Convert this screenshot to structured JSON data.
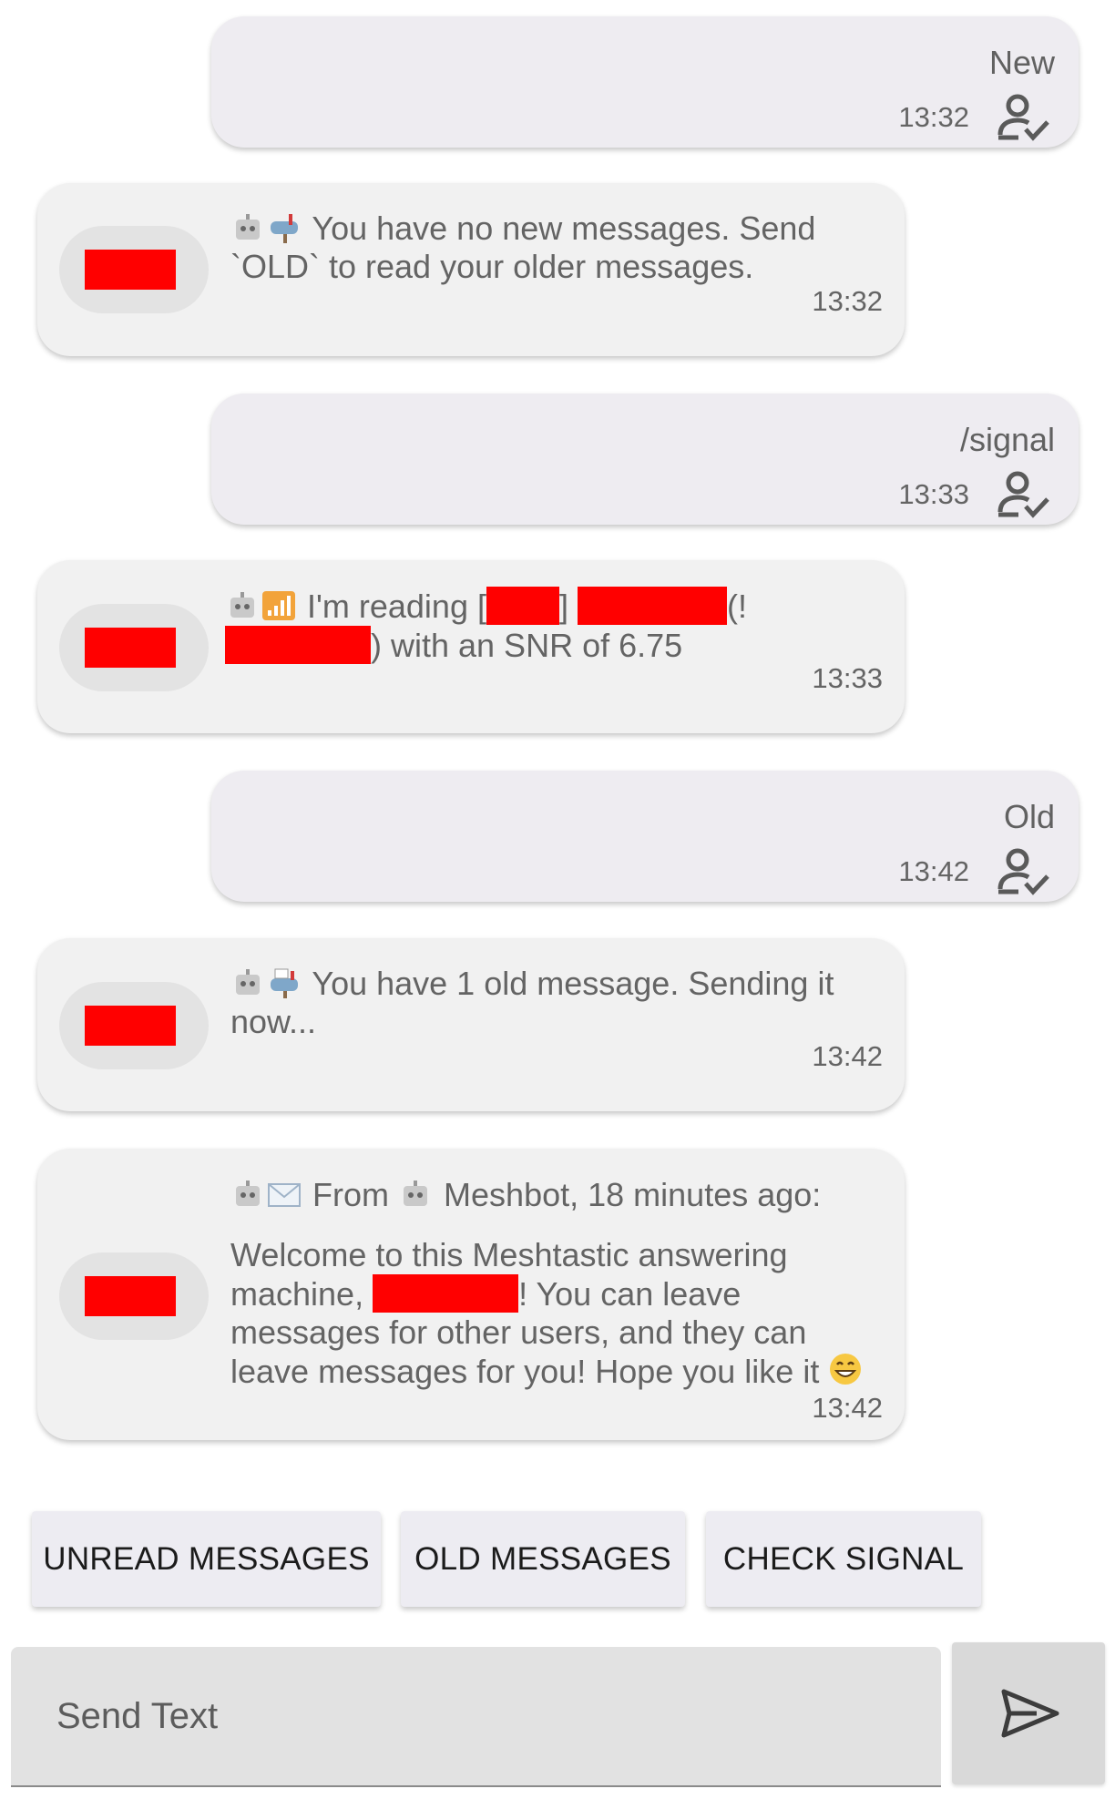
{
  "conversation": {
    "m1": {
      "text": "New",
      "time": "13:32"
    },
    "m2": {
      "text": "You have no new messages. Send `OLD` to read your older messages.",
      "time": "13:32"
    },
    "m3": {
      "text": "/signal",
      "time": "13:33"
    },
    "m4": {
      "part1": "I'm reading [",
      "part2": "]",
      "part3": "(!",
      "part4": ") with an SNR of 6.75",
      "time": "13:33"
    },
    "m5": {
      "text": "Old",
      "time": "13:42"
    },
    "m6": {
      "text": "You have 1 old message. Sending it now...",
      "time": "13:42"
    },
    "m7": {
      "header_from": "From",
      "header_sender": "Meshbot, 18 minutes ago:",
      "body_part1": "Welcome to this Meshtastic answering machine,",
      "body_part2": "! You can leave messages for other users, and they can leave messages for you! Hope you like it",
      "time": "13:42"
    }
  },
  "quick_replies": {
    "unread": "UNREAD MESSAGES",
    "old": "OLD MESSAGES",
    "signal": "CHECK SIGNAL"
  },
  "composer": {
    "placeholder": "Send Text"
  },
  "colors": {
    "redaction": "#ff0000",
    "outgoing_bubble": "#eeecf1",
    "incoming_bubble": "#f1f1f1"
  }
}
